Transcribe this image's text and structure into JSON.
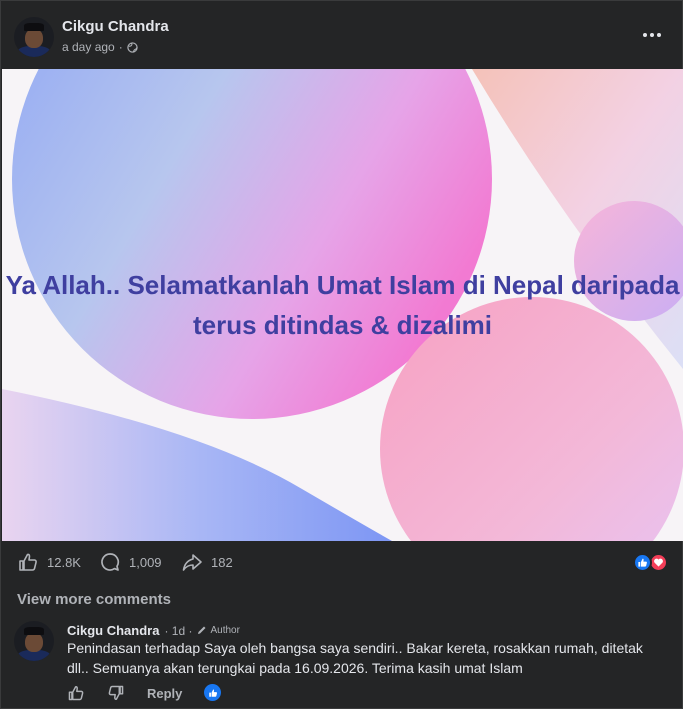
{
  "post": {
    "author": "Cikgu Chandra",
    "timestamp": "a day ago",
    "separator": "·",
    "privacy_icon": "globe-icon",
    "image_text": "Ya Allah.. Selamatkanlah Umat Islam di Nepal daripada terus ditindas & dizalimi"
  },
  "actions": {
    "likes": "12.8K",
    "comments": "1,009",
    "shares": "182",
    "reaction_icons": [
      "like-icon",
      "love-icon"
    ]
  },
  "comments_section": {
    "view_more_label": "View more comments"
  },
  "comment": {
    "author": "Cikgu Chandra",
    "time": "· 1d ·",
    "badge": "Author",
    "text": "Penindasan terhadap Saya oleh bangsa saya sendiri.. Bakar kereta, rosakkan rumah, ditetak dll.. Semuanya akan terungkai pada 16.09.2026. Terima kasih umat Islam",
    "reply_label": "Reply"
  },
  "colors": {
    "background": "#242526",
    "text_primary": "#e4e6eb",
    "text_secondary": "#b0b3b8",
    "image_text": "#3f3fa0",
    "like_blue": "#1877f2",
    "love_red": "#f33e58"
  }
}
